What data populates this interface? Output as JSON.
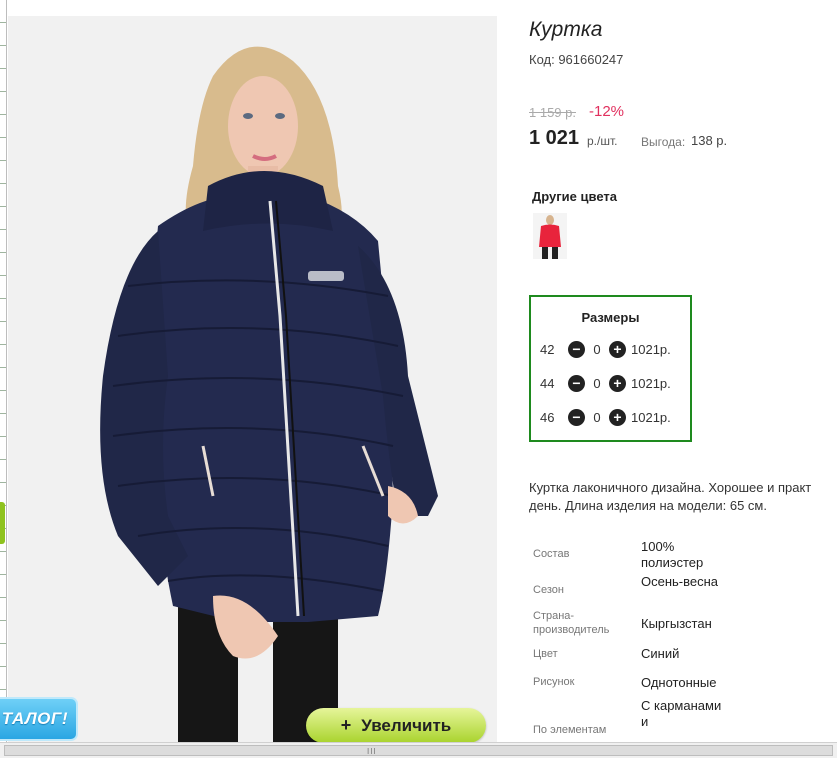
{
  "product": {
    "title": "Куртка",
    "code": "Код: 961660247",
    "old_price": "1 159 р.",
    "discount": "-12%",
    "price": "1 021",
    "price_unit": "р./шт.",
    "savings_label": "Выгода:",
    "savings_value": "138 р."
  },
  "other_colors": {
    "heading": "Другие цвета",
    "swatch_color": "#e8243c"
  },
  "sizes": {
    "heading": "Размеры",
    "minus_symbol": "−",
    "plus_symbol": "+",
    "rows": [
      {
        "size": "42",
        "qty": "0",
        "price": "1021р."
      },
      {
        "size": "44",
        "qty": "0",
        "price": "1021р."
      },
      {
        "size": "46",
        "qty": "0",
        "price": "1021р."
      }
    ]
  },
  "description": {
    "line1": "Куртка лаконичного дизайна. Хорошее и практ",
    "line2": "день. Длина изделия на модели: 65 см."
  },
  "properties": [
    {
      "label": "Состав",
      "value": "100% полиэстер"
    },
    {
      "label": "Сезон",
      "value": "Осень-весна"
    },
    {
      "label": "Страна-производитель",
      "value": "Кыргызстан"
    },
    {
      "label": "Цвет",
      "value": "Синий"
    },
    {
      "label": "Рисунок",
      "value": "Однотонные"
    },
    {
      "label": "По элементам",
      "value": "С карманами и"
    }
  ],
  "image_controls": {
    "zoom_label": "Увеличить",
    "zoom_plus": "+",
    "catalog_badge": "ТАЛОГ!"
  },
  "scrollbar": {
    "grip": "III"
  },
  "colors": {
    "accent_green_border": "#1e8a1e",
    "discount_red": "#e1305e",
    "jacket_navy": "#232a4f"
  }
}
